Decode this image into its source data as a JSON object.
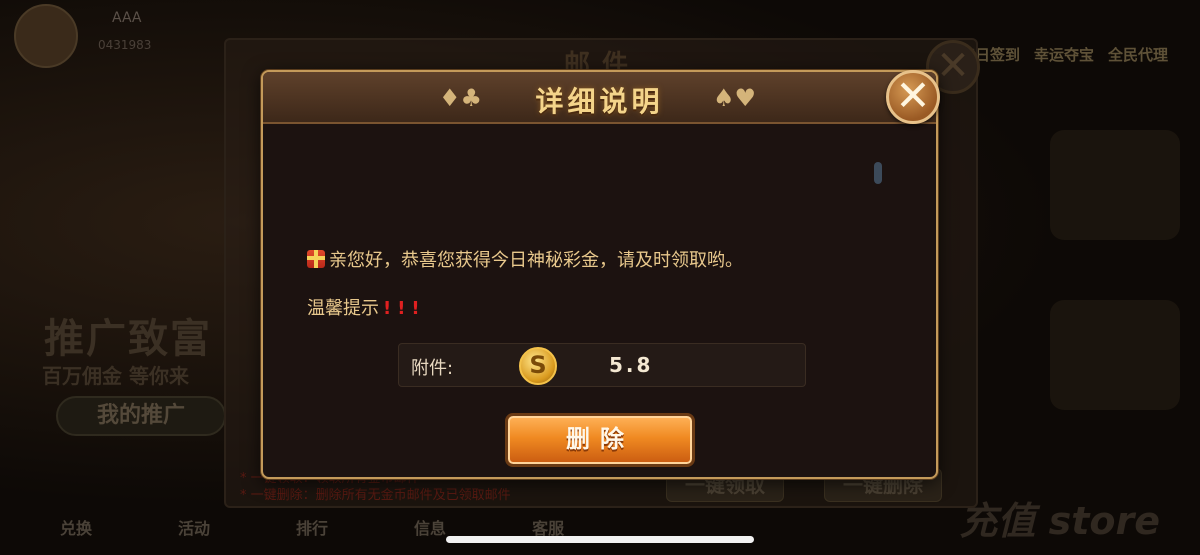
{
  "background": {
    "user": {
      "name": "AAA",
      "id": "0431983"
    },
    "top_actions": [
      "每日签到",
      "幸运夺宝",
      "全民代理"
    ],
    "promo": {
      "title": "推广致富",
      "subtitle": "百万佣金 等你来",
      "button": "我的推广"
    },
    "bottom_nav": [
      "兑换",
      "活动",
      "排行",
      "信息",
      "客服"
    ],
    "store_label": "充值 store"
  },
  "mail": {
    "title": "邮件",
    "notes": [
      "* 一键领取：领取所有金币邮件",
      "* 一键删除：删除所有无金币邮件及已领取邮件"
    ],
    "claim_all": "一键领取",
    "delete_all": "一键删除",
    "close_label": "✕"
  },
  "dialog": {
    "title": "详细说明",
    "close_label": "✕",
    "message": "亲您好，恭喜您获得今日神秘彩金，请及时领取哟。",
    "tip": "温馨提示",
    "tip_marks": "!!!",
    "attachment_label": "附件:",
    "attachment_value": "5.8",
    "coin_symbol": "S",
    "delete_button": "删除",
    "colors": {
      "accent": "#f08a22",
      "text": "#e8c88c",
      "border": "#c49a5a"
    }
  }
}
